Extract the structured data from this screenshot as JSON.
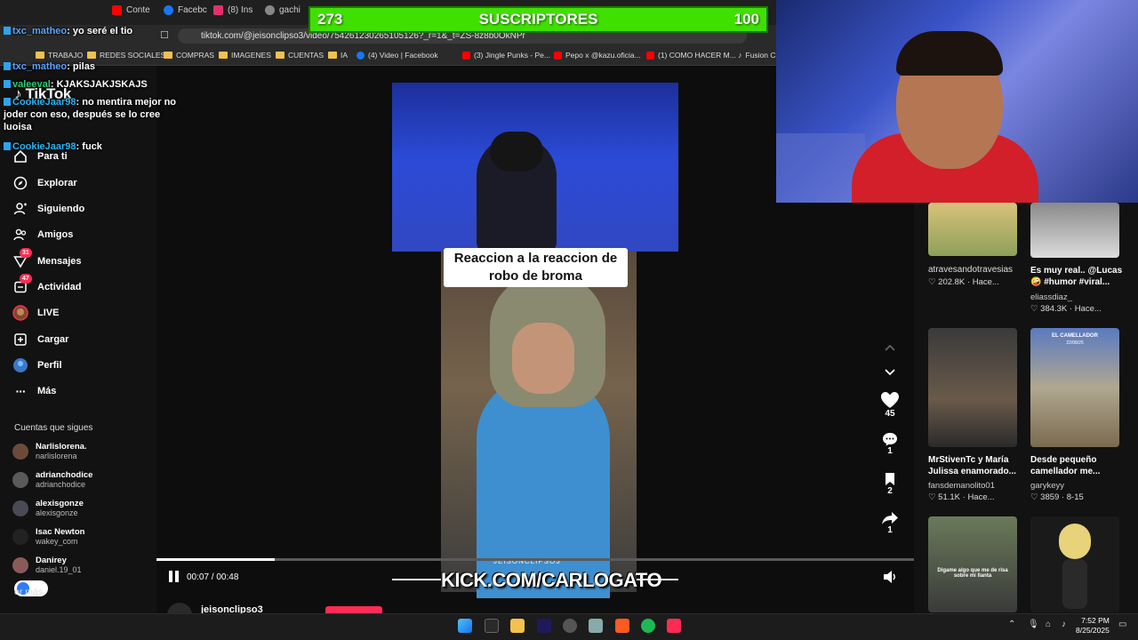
{
  "browser": {
    "tabs": [
      {
        "label": "Conte",
        "color": "#ff0000"
      },
      {
        "label": "Facebc",
        "color": "#1877f2"
      },
      {
        "label": "(8) Ins",
        "color": "#e1306c"
      },
      {
        "label": "gachi",
        "color": "#888888"
      }
    ],
    "url": "tiktok.com/@jeisonclipso3/video/754261230265105126?_r=1&_t=ZS-8z8b0OkNPr",
    "bookmarks": [
      "TRABAJO",
      "REDES SOCIALES",
      "COMPRAS",
      "IMAGENES",
      "CUENTAS",
      "IA",
      "(4) Video | Facebook",
      "(3) Jingle Punks - Pe...",
      "Pepo x @kazu.oficia...",
      "(1) COMO HACER M...",
      "Fusion Cl"
    ]
  },
  "subs": {
    "current": "273",
    "label": "SUSCRIPTORES",
    "goal": "100"
  },
  "chat": [
    {
      "user": "txc_matheo",
      "text": "yo seré el tio"
    },
    {
      "user": "txc_matheo",
      "text": "pilas"
    },
    {
      "user": "valeeval",
      "text": "KJAKSJAKJSKAJS"
    },
    {
      "user": "CookieJaar98",
      "text": "no mentira mejor no joder con eso, después se lo cree luoisa"
    },
    {
      "user": "CookieJaar98",
      "text": "fuck"
    }
  ],
  "sidebar": {
    "logo": "TikTok",
    "nav": [
      {
        "label": "Para ti",
        "badge": ""
      },
      {
        "label": "Explorar",
        "badge": ""
      },
      {
        "label": "Siguiendo",
        "badge": ""
      },
      {
        "label": "Amigos",
        "badge": ""
      },
      {
        "label": "Mensajes",
        "badge": "31"
      },
      {
        "label": "Actividad",
        "badge": "47"
      },
      {
        "label": "LIVE",
        "badge": ""
      },
      {
        "label": "Cargar",
        "badge": ""
      },
      {
        "label": "Perfil",
        "badge": ""
      },
      {
        "label": "Más",
        "badge": ""
      }
    ],
    "following_title": "Cuentas que sigues",
    "following": [
      {
        "name": "Narlislorena.",
        "handle": "narlislorena"
      },
      {
        "name": "adrianchodice",
        "handle": "adrianchodice"
      },
      {
        "name": "alexisgonze",
        "handle": "alexisgonze"
      },
      {
        "name": "Isac Newton",
        "handle": "wakey_com"
      },
      {
        "name": "Danirey",
        "handle": "daniel.19_01"
      }
    ],
    "see_more": "er más"
  },
  "video": {
    "caption": "Reaccion a la reaccion de robo de broma",
    "watermark": "JEISONCLIPSO3",
    "kick": "KICK.COM/CARLOGATO",
    "time": "00:07 / 00:48",
    "progress": 0.156,
    "author": "jeisonclipso3"
  },
  "actions": {
    "likes": "45",
    "comments": "1",
    "saves": "2",
    "shares": "1"
  },
  "recommended": [
    {
      "title": "",
      "author": "atravesandotravesias",
      "likes": "202.8K",
      "time": "Hace..."
    },
    {
      "title": "Es muy real.. @Lucas 🤪 #humor #viral...",
      "author": "eliassdiaz_",
      "likes": "384.3K",
      "time": "Hace..."
    },
    {
      "title": "MrStivenTc y María Julissa enamorado...",
      "author": "fansdemanolito01",
      "likes": "51.1K",
      "time": "Hace..."
    },
    {
      "title": "Desde pequeño camellador me...",
      "author": "garykeyy",
      "likes": "3859",
      "time": "8-15"
    }
  ],
  "thumb_text": {
    "camellador": "EL CAMELLADOR",
    "camellador_date": "22/08/25",
    "dime": "Digame algo que me de risa sobre mi llanta"
  },
  "clock": {
    "time": "7:52 PM",
    "date": "8/25/2025"
  },
  "colors": {
    "tiktok_red": "#fe2c55",
    "kick_green": "#53fc18",
    "subs_green": "#3fe000"
  }
}
